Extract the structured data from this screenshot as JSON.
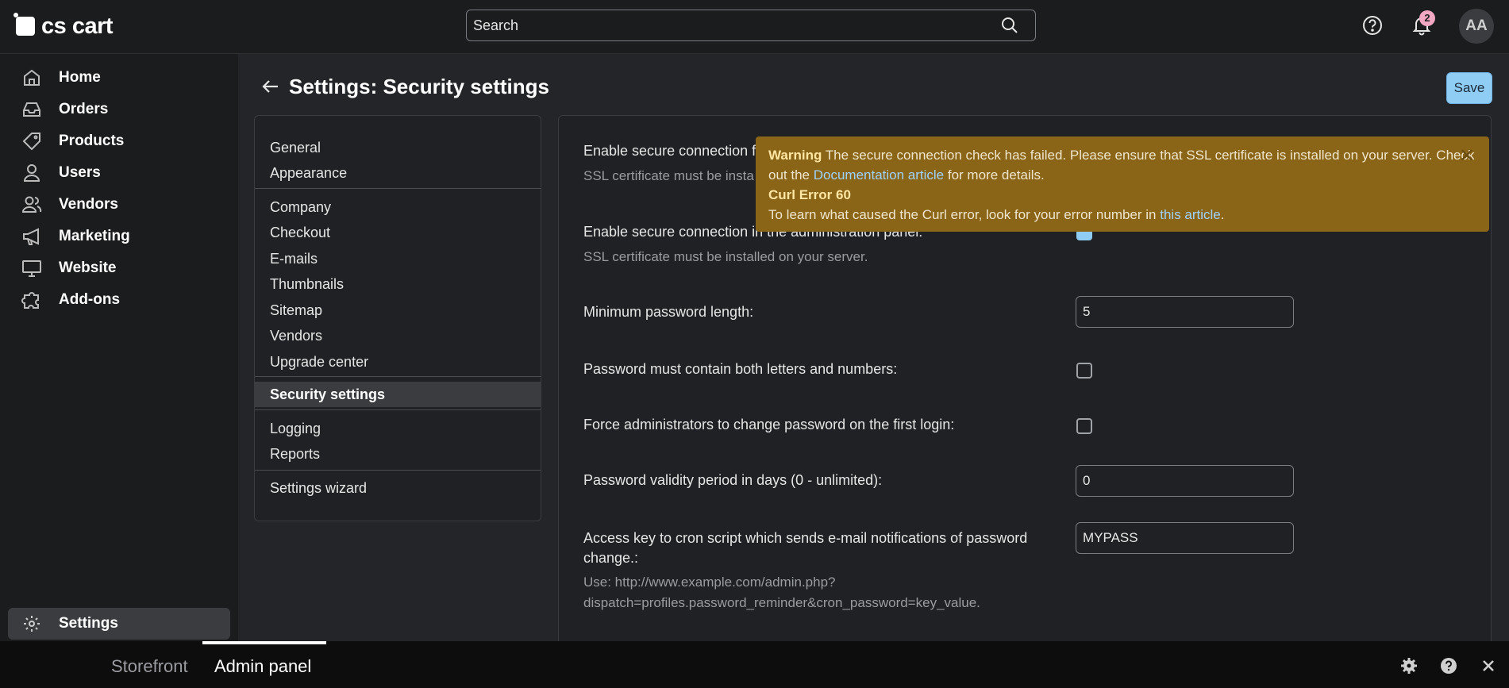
{
  "app": {
    "logo_text": "cs cart"
  },
  "topbar": {
    "search_placeholder": "Search",
    "notification_count": "2",
    "avatar_initials": "AA"
  },
  "sidebar": {
    "items": [
      {
        "label": "Home",
        "icon": "home-icon"
      },
      {
        "label": "Orders",
        "icon": "inbox-icon"
      },
      {
        "label": "Products",
        "icon": "tag-icon"
      },
      {
        "label": "Users",
        "icon": "user-icon"
      },
      {
        "label": "Vendors",
        "icon": "users-icon"
      },
      {
        "label": "Marketing",
        "icon": "megaphone-icon"
      },
      {
        "label": "Website",
        "icon": "monitor-icon"
      },
      {
        "label": "Add-ons",
        "icon": "puzzle-icon"
      }
    ],
    "settings_label": "Settings"
  },
  "page": {
    "title": "Settings: Security settings",
    "save_label": "Save"
  },
  "settings_nav": {
    "groups": [
      [
        "General",
        "Appearance"
      ],
      [
        "Company",
        "Checkout",
        "E-mails",
        "Thumbnails",
        "Sitemap",
        "Vendors",
        "Upgrade center"
      ],
      [
        "Security settings"
      ],
      [
        "Logging",
        "Reports"
      ],
      [
        "Settings wizard"
      ]
    ],
    "active": "Security settings"
  },
  "warning": {
    "title": "Warning",
    "text1": " The secure connection check has failed. Please ensure that SSL certificate is installed on your server. Check out the ",
    "link1": "Documentation article",
    "text2": " for more details.",
    "error_title": "Curl Error 60",
    "text3": "To learn what caused the Curl error, look for your error number in ",
    "link2": "this article",
    "text4": "."
  },
  "form": {
    "secure_storefront_label": "Enable secure connection fo",
    "secure_storefront_hint": "SSL certificate must be insta",
    "secure_admin_label": "Enable secure connection in the administration panel:",
    "secure_admin_hint": "SSL certificate must be installed on your server.",
    "min_password_label": "Minimum password length:",
    "min_password_value": "5",
    "letters_numbers_label": "Password must contain both letters and numbers:",
    "force_change_label": "Force administrators to change password on the first login:",
    "validity_label": "Password validity period in days (0 - unlimited):",
    "validity_value": "0",
    "cron_label_1": "Access key to cron script which sends e-mail notifications of password",
    "cron_label_2": "change.:",
    "cron_value": "MYPASS",
    "cron_hint_1": "Use: http://www.example.com/admin.php?",
    "cron_hint_2": "dispatch=profiles.password_reminder&cron_password=key_value."
  },
  "bottombar": {
    "storefront_label": "Storefront",
    "admin_label": "Admin panel"
  }
}
